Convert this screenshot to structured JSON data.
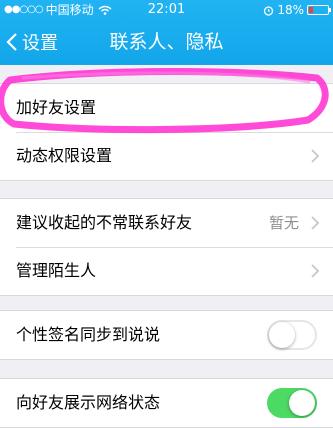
{
  "status_bar": {
    "carrier": "中国移动",
    "time": "22:01",
    "battery": "18%",
    "battery_color": "#ff3b30"
  },
  "nav": {
    "back_label": "设置",
    "title": "联系人、隐私"
  },
  "sections": [
    {
      "rows": [
        {
          "label": "加好友设置"
        },
        {
          "label": "动态权限设置"
        }
      ]
    },
    {
      "rows": [
        {
          "label": "建议收起的不常联系好友",
          "value": "暂无"
        },
        {
          "label": "管理陌生人"
        }
      ]
    },
    {
      "rows": [
        {
          "label": "个性签名同步到说说",
          "toggle": "off"
        }
      ]
    },
    {
      "rows": [
        {
          "label": "向好友展示网络状态",
          "toggle": "on"
        }
      ]
    }
  ],
  "colors": {
    "header": "#12a6ea",
    "highlight_stroke": "#ff2bd0",
    "toggle_on": "#4cd964"
  },
  "icons": [
    "signal-dots-icon",
    "wifi-icon",
    "alarm-icon",
    "battery-icon",
    "back-chevron-icon",
    "chevron-right-icon"
  ]
}
